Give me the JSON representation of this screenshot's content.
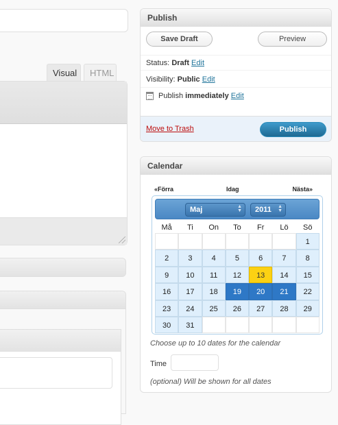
{
  "editor": {
    "tab_visual": "Visual",
    "tab_html": "HTML"
  },
  "publish": {
    "title": "Publish",
    "save_draft": "Save Draft",
    "preview": "Preview",
    "status_label": "Status:",
    "status_value": "Draft",
    "status_edit": "Edit",
    "visibility_label": "Visibility:",
    "visibility_value": "Public",
    "visibility_edit": "Edit",
    "publish_label": "Publish",
    "publish_value": "immediately",
    "publish_edit": "Edit",
    "trash": "Move to Trash",
    "publish_button": "Publish"
  },
  "calendar": {
    "title": "Calendar",
    "prev": "«Förra",
    "today": "Idag",
    "next": "Nästa»",
    "month": "Maj",
    "year": "2011",
    "weekdays": [
      "Må",
      "Ti",
      "On",
      "To",
      "Fr",
      "Lö",
      "Sö"
    ],
    "weeks": [
      [
        "",
        "",
        "",
        "",
        "",
        "",
        "1"
      ],
      [
        "2",
        "3",
        "4",
        "5",
        "6",
        "7",
        "8"
      ],
      [
        "9",
        "10",
        "11",
        "12",
        "13",
        "14",
        "15"
      ],
      [
        "16",
        "17",
        "18",
        "19",
        "20",
        "21",
        "22"
      ],
      [
        "23",
        "24",
        "25",
        "26",
        "27",
        "28",
        "29"
      ],
      [
        "30",
        "31",
        "",
        "",
        "",
        "",
        ""
      ]
    ],
    "today_date": "13",
    "selected_dates": [
      "19",
      "20",
      "21"
    ],
    "hint": "Choose up to 10 dates for the calendar",
    "time_label": "Time",
    "time_value": "",
    "time_hint": "(optional) Will be shown for all dates"
  },
  "colors": {
    "link": "#21759b",
    "trash": "#bc0b0b",
    "publish_button": "#2a7fb1",
    "selected_day": "#2e78c6",
    "today_day": "#fcd113"
  }
}
